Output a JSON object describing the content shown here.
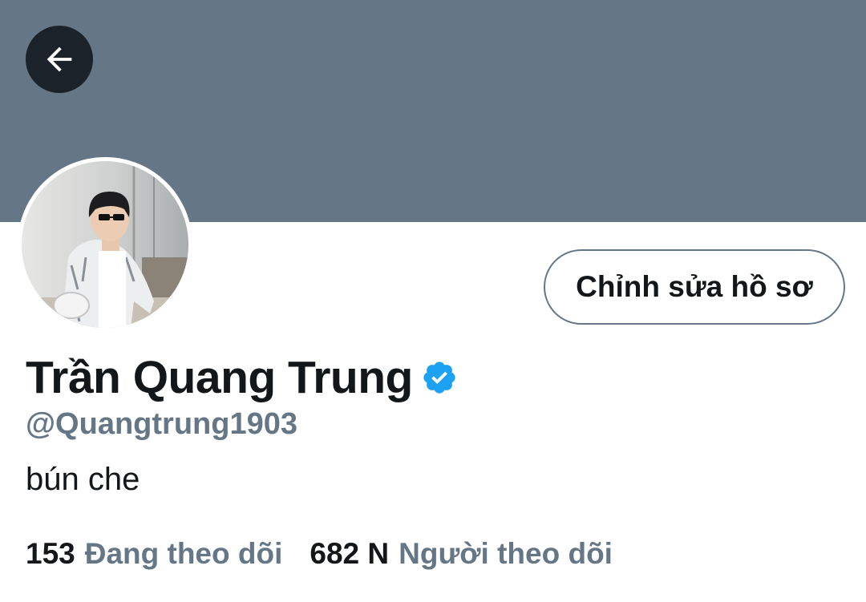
{
  "header": {
    "banner_color": "#657786",
    "back_icon": "arrow-left-icon"
  },
  "profile": {
    "display_name": "Trần Quang Trung",
    "verified_icon": "verified-badge-icon",
    "verified_color": "#1da1f2",
    "handle": "@Quangtrung1903",
    "bio": "bún che",
    "edit_button_label": "Chỉnh sửa hồ sơ"
  },
  "stats": {
    "following_count": "153",
    "following_label": "Đang theo dõi",
    "followers_count": "682 N",
    "followers_label": "Người theo dõi"
  },
  "colors": {
    "text_primary": "#14171a",
    "text_secondary": "#657786",
    "accent": "#1da1f2"
  }
}
